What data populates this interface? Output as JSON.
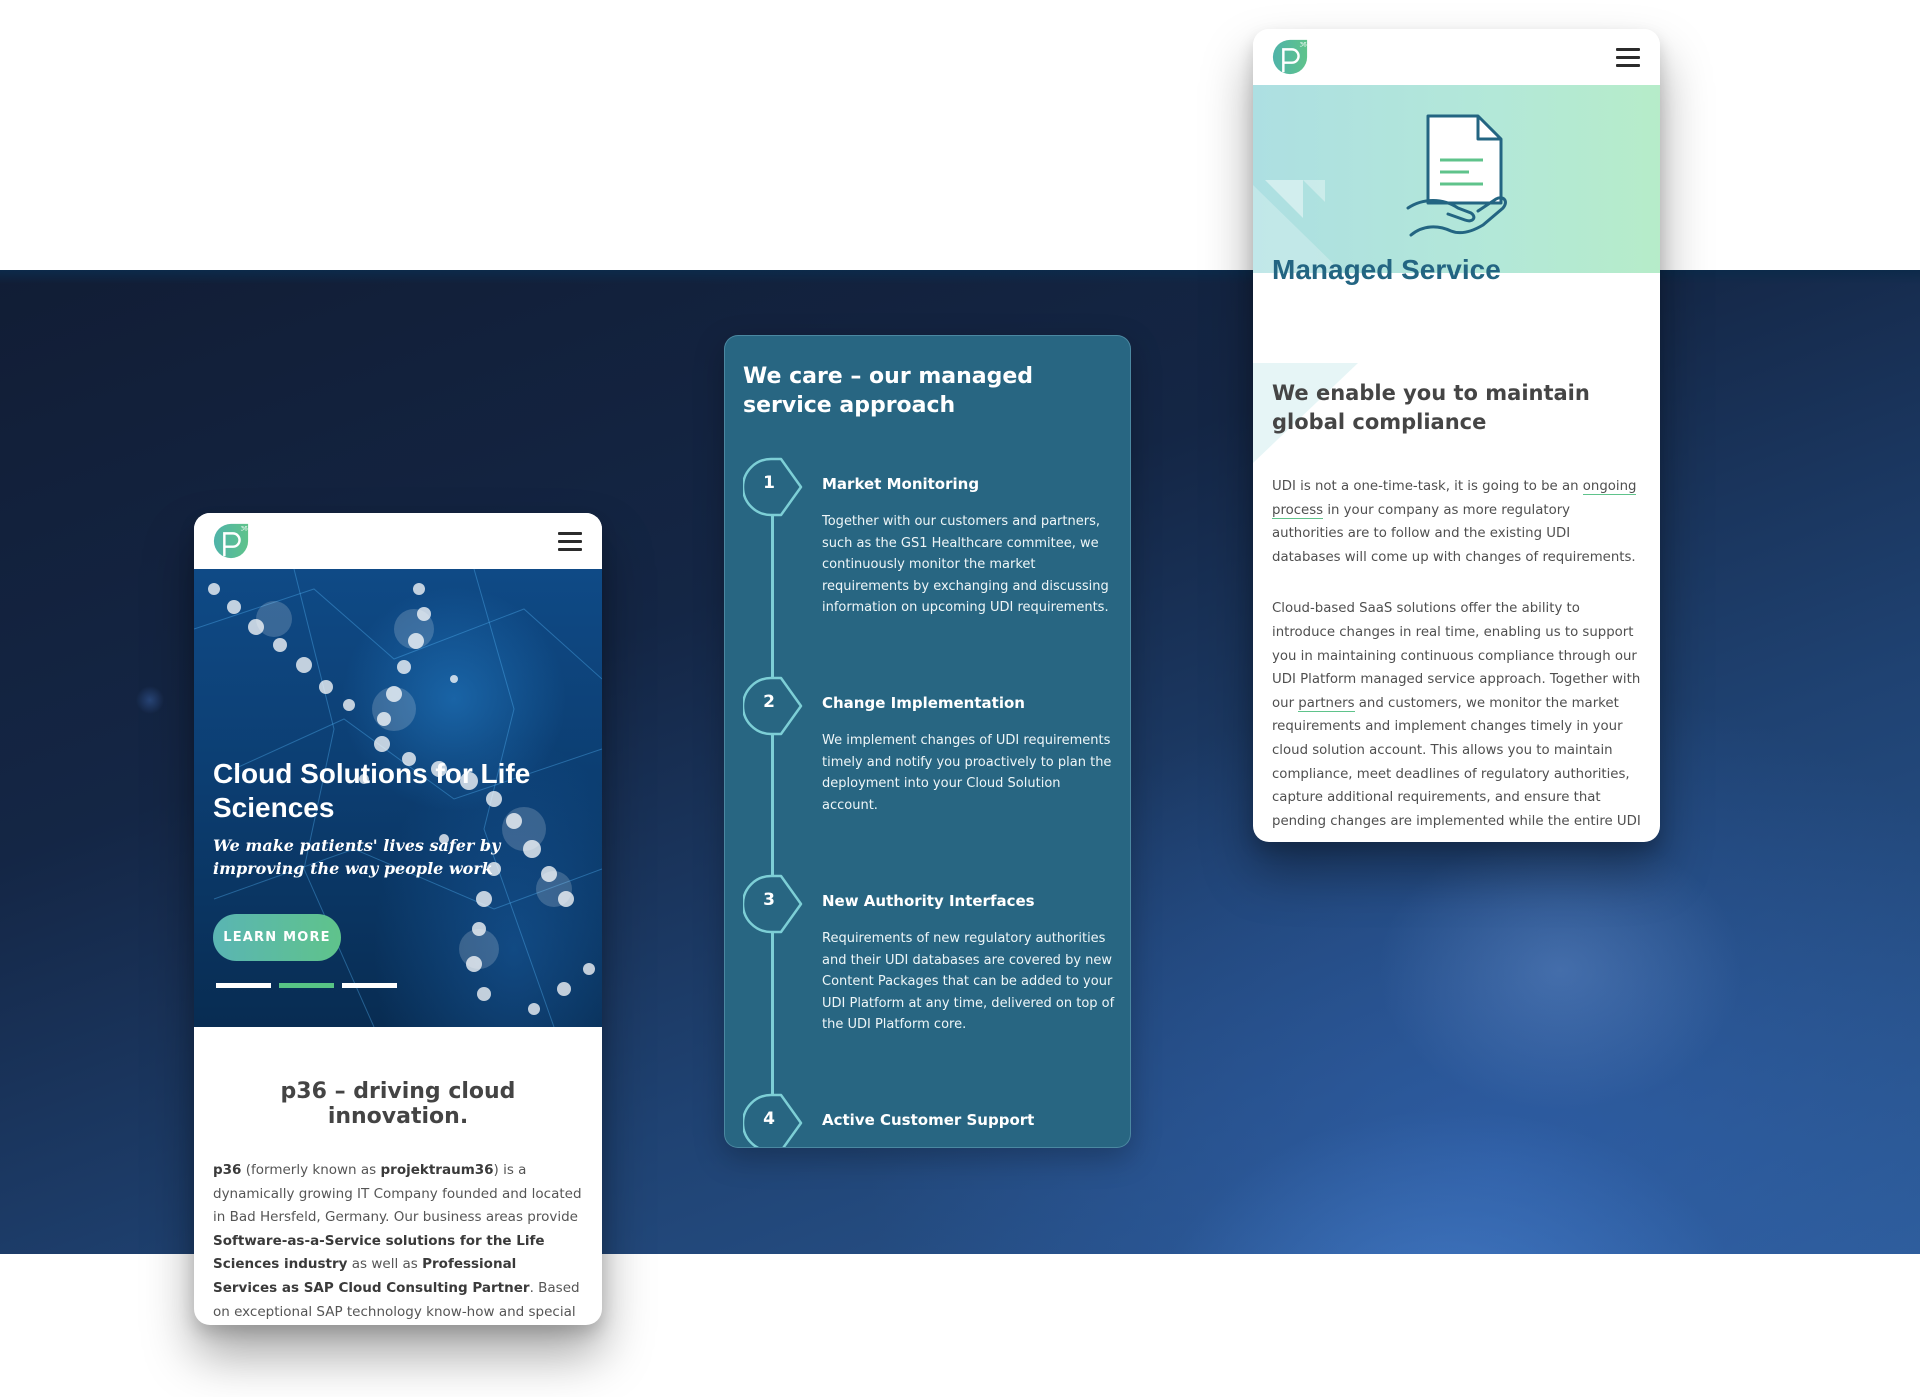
{
  "colors": {
    "brand_teal": "#286682",
    "brand_green": "#5fc38b",
    "brand_blue_text": "#236582",
    "active_dot": "#58c485",
    "timeline": "#7dcfd6"
  },
  "left_phone": {
    "header": {
      "logo": "p36-logo",
      "logo_superscript": "36",
      "menu_icon": "hamburger-icon"
    },
    "hero": {
      "title": "Cloud Solutions for Life Sciences",
      "subtitle": "We make patients' lives safer by improving the way people work",
      "cta_label": "LEARN MORE",
      "slides": {
        "count": 3,
        "active_index": 2
      }
    },
    "intro": {
      "title": "p36 – driving cloud innovation.",
      "segments": [
        {
          "text": "p36",
          "bold": true
        },
        {
          "text": " (formerly known as ",
          "bold": false
        },
        {
          "text": "projektraum36",
          "bold": true
        },
        {
          "text": ") is a dynamically growing IT Company founded and located in Bad Hersfeld, Germany. Our business areas provide ",
          "bold": false
        },
        {
          "text": "Software-as-a-Service solutions for the Life Sciences industry",
          "bold": true
        },
        {
          "text": " as well as ",
          "bold": false
        },
        {
          "text": "Professional Services as SAP Cloud Consulting Partner",
          "bold": true
        },
        {
          "text": ". Based on exceptional SAP technology know-how and special expertise in regulatory topics, we develop and operate Cloud-based",
          "bold": false
        }
      ]
    }
  },
  "middle_card": {
    "title": "We care – our managed service approach",
    "steps": [
      {
        "number": "1",
        "title": "Market Monitoring",
        "text": "Together with our customers and partners, such as the GS1 Healthcare commitee, we continuously monitor the market requirements by exchanging and discussing information on upcoming UDI requirements."
      },
      {
        "number": "2",
        "title": "Change Implementation",
        "text": "We implement changes of UDI requirements timely and notify you proactively to plan the deployment into your Cloud Solution account."
      },
      {
        "number": "3",
        "title": "New Authority Interfaces",
        "text": "Requirements of new regulatory authorities and their UDI databases are covered by new Content Packages that can be added to your UDI Platform at any time, delivered on top of the UDI Platform core."
      },
      {
        "number": "4",
        "title": "Active Customer Support",
        "text": ""
      }
    ]
  },
  "right_phone": {
    "header": {
      "logo": "p36-logo",
      "logo_superscript": "36",
      "menu_icon": "hamburger-icon"
    },
    "hero": {
      "icon": "document-in-hand-icon",
      "title": "Managed Service"
    },
    "body": {
      "heading": "We enable you to maintain global compliance",
      "para1": {
        "before": "UDI is not a one-time-task, it is going to be an ",
        "link": "ongoing process",
        "after": " in your company as more regulatory authorities are to follow and the existing UDI databases will come up with changes of requirements."
      },
      "para2": {
        "before": "Cloud-based SaaS solutions offer the ability to introduce changes in real time, enabling us to support you in maintaining continuous compliance through our UDI Platform managed service approach. Together with our ",
        "link": "partners",
        "after": " and customers, we monitor the market requirements and implement changes timely in your cloud solution account. This allows you to maintain compliance, meet deadlines of regulatory authorities, capture additional requirements, and ensure that pending changes are implemented while the entire UDI"
      }
    }
  }
}
